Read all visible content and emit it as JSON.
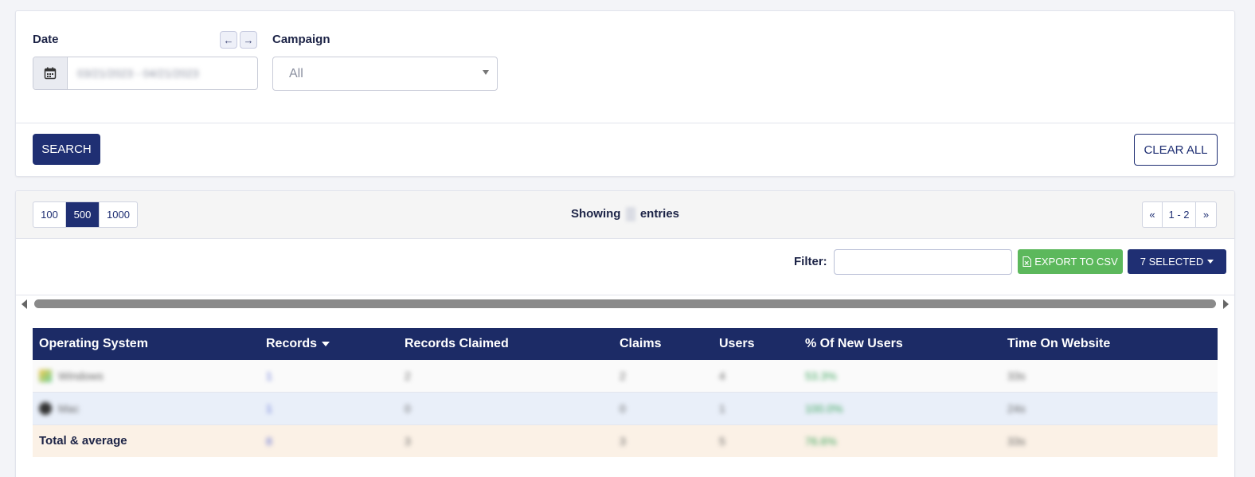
{
  "filters": {
    "date_label": "Date",
    "date_value": "03/21/2023 - 04/21/2023",
    "campaign_label": "Campaign",
    "campaign_value": "All",
    "search_label": "SEARCH",
    "clear_label": "CLEAR ALL",
    "prev_icon": "arrow-left-icon",
    "next_icon": "arrow-right-icon",
    "calendar_icon": "calendar-icon"
  },
  "toolbar": {
    "page_sizes": [
      "100",
      "500",
      "1000"
    ],
    "active_page_size": "500",
    "showing_prefix": "Showing",
    "showing_suffix": "entries",
    "pager_prev": "«",
    "pager_range": "1 - 2",
    "pager_next": "»",
    "filter_label": "Filter:",
    "filter_value": "",
    "export_label": "EXPORT TO CSV",
    "selected_label": "7 SELECTED"
  },
  "table": {
    "columns": [
      "Operating System",
      "Records",
      "Records Claimed",
      "Claims",
      "Users",
      "% Of New Users",
      "Time On Website"
    ],
    "rows": [
      {
        "os": "Windows",
        "records": "1",
        "records_claimed": "2",
        "claims": "2",
        "users": "4",
        "pct_new": "53.3%",
        "time": "33s"
      },
      {
        "os": "Mac",
        "records": "1",
        "records_claimed": "0",
        "claims": "0",
        "users": "1",
        "pct_new": "100.0%",
        "time": "24s"
      }
    ],
    "total": {
      "label": "Total & average",
      "records": "8",
      "records_claimed": "3",
      "claims": "3",
      "users": "5",
      "pct_new": "76.6%",
      "time": "33s"
    }
  },
  "colors": {
    "primary": "#1f2f73",
    "header": "#1c2b66",
    "success": "#5cb85c"
  }
}
